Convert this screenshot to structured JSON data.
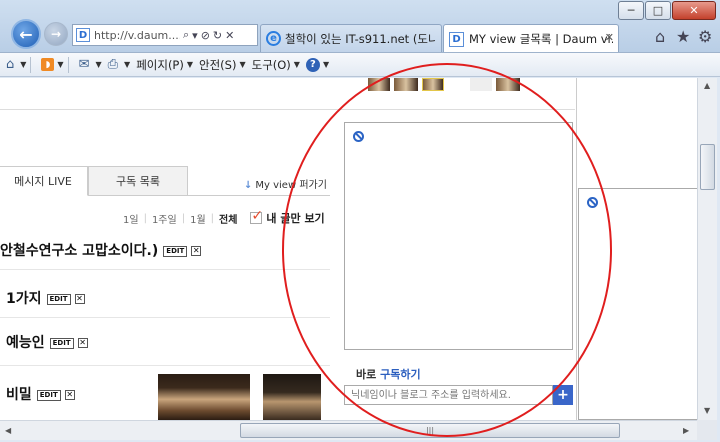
{
  "browser": {
    "url": "http://v.daum....",
    "tabs": [
      {
        "label": "철학이 있는 IT-s911.net (도니..."
      },
      {
        "label": "MY view 글목록 | Daum vi..."
      }
    ],
    "window_controls": {
      "minimize": "─",
      "maximize": "□",
      "close": "✕"
    },
    "nav": {
      "back": "←",
      "forward": "→"
    },
    "address_icons": {
      "search": "⌕",
      "dropdown": "▾",
      "stop": "⊘",
      "refresh": "↻",
      "close": "✕"
    },
    "right_icons": {
      "home": "⌂",
      "favorites": "★",
      "tools": "⚙"
    },
    "command_bar": {
      "page": "페이지(P)",
      "safety": "안전(S)",
      "tools": "도구(O)",
      "help": "?"
    }
  },
  "page": {
    "tabs": [
      {
        "label": "메시지 LIVE"
      },
      {
        "label": "구독 목록"
      }
    ],
    "share_link": "My view 퍼가기",
    "period_filter": [
      "1일",
      "1주일",
      "1월",
      "전체"
    ],
    "mine_filter": "내 글만 보기",
    "posts": [
      {
        "title": "안철수연구소 고맙소이다.)"
      },
      {
        "title": "1가지"
      },
      {
        "title": "예능인"
      },
      {
        "title": "비밀"
      }
    ],
    "tag_edit": "EDIT",
    "tag_delete": "✕",
    "subscribe": {
      "prefix": "바로",
      "link": "구독하기",
      "placeholder": "닉네임이나 블로그 주소를 입력하세요.",
      "button": "+"
    }
  },
  "scrollbar": {
    "grip": "|||"
  },
  "colors": {
    "annotation": "#e01e1e",
    "accent": "#2c5fbf"
  }
}
